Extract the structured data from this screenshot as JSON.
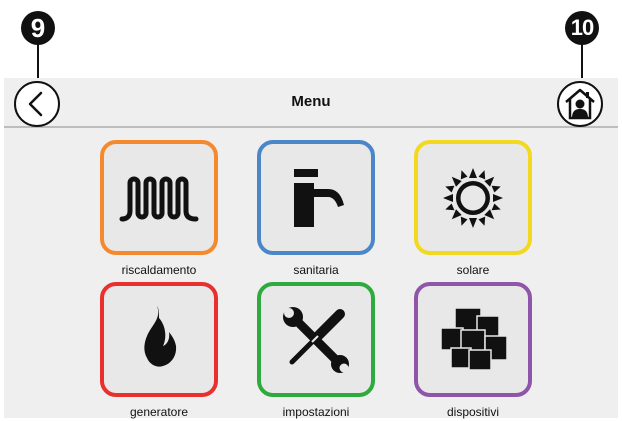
{
  "callouts": {
    "left": "9",
    "right": "10"
  },
  "header": {
    "title": "Menu",
    "back_icon": "chevron-left-icon",
    "home_icon": "home-user-icon"
  },
  "tiles": [
    {
      "label": "riscaldamento",
      "color": "#f5892e",
      "icon": "radiator-icon"
    },
    {
      "label": "sanitaria",
      "color": "#4a86c8",
      "icon": "faucet-icon"
    },
    {
      "label": "solare",
      "color": "#f2d81e",
      "icon": "sun-icon"
    },
    {
      "label": "generatore",
      "color": "#e8302f",
      "icon": "flame-icon"
    },
    {
      "label": "impostazioni",
      "color": "#2faa3c",
      "icon": "tools-icon"
    },
    {
      "label": "dispositivi",
      "color": "#8e55a8",
      "icon": "devices-icon"
    }
  ]
}
